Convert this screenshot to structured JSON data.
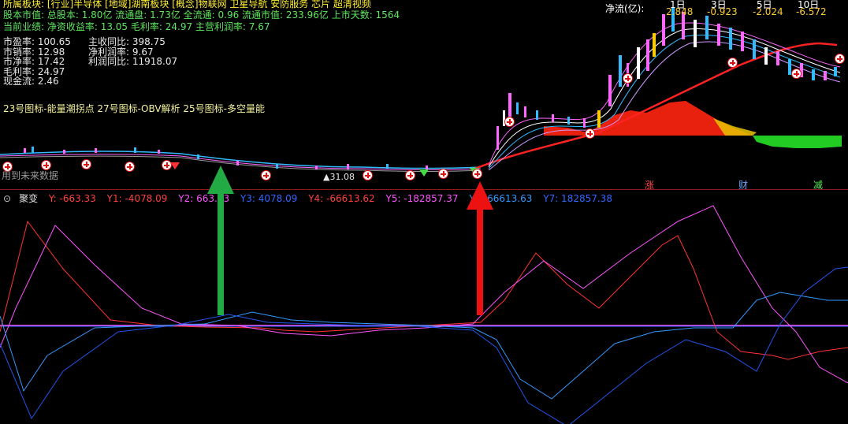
{
  "header": {
    "industry_line": "所属板块: [行业]半导体 [地域]湖南板块 [概念]物联网 卫星导航 安防服务 芯片 超清视频",
    "capital_line": "股本市值: 总股本: 1.80亿 流通盘: 1.73亿 全流通: 0.96 流通市值: 233.96亿 上市天数: 1564",
    "performance_line": "当前业绩:  净资收益率: 13.05 毛利率: 24.97 主营利润率: 7.67"
  },
  "financials": {
    "left": [
      {
        "label": "市盈率:",
        "value": "100.65"
      },
      {
        "label": "市销率:",
        "value": "12.98"
      },
      {
        "label": "市净率:",
        "value": "17.42"
      },
      {
        "label": "毛利率:",
        "value": "24.97"
      },
      {
        "label": "现金流:",
        "value": "2.46"
      }
    ],
    "right": [
      {
        "label": "主收同比:",
        "value": "398.75"
      },
      {
        "label": "净利润率:",
        "value": "9.67"
      },
      {
        "label": "利润同比:",
        "value": "11918.07"
      }
    ]
  },
  "net_flow": {
    "label": "净流(亿):",
    "columns": [
      {
        "head": "1日",
        "value": "2.848"
      },
      {
        "head": "3日",
        "value": "-0.923"
      },
      {
        "head": "5日",
        "value": "-2.024"
      },
      {
        "head": "10日",
        "value": "-6.572"
      }
    ]
  },
  "indicator_caption": "23号图标-能量潮拐点 27号图标-OBV解析 25号图标-多空量能",
  "future_data_text": "用到未来数据",
  "low_price_label": "31.08",
  "badges": {
    "zhang": "涨",
    "cai": "财",
    "jian": "减"
  },
  "lower_panel": {
    "title": "聚变",
    "legend": [
      {
        "label": "Y: -663.33",
        "color": "#ff4040"
      },
      {
        "label": "Y1: -4078.09",
        "color": "#ff4040"
      },
      {
        "label": "Y2: 663.33",
        "color": "#ff55ff"
      },
      {
        "label": "Y3: 4078.09",
        "color": "#3366ff"
      },
      {
        "label": "Y4: -66613.62",
        "color": "#ff4040"
      },
      {
        "label": "Y5: -182857.37",
        "color": "#ff55ff"
      },
      {
        "label": "Y6: 66613.63",
        "color": "#3399ff"
      },
      {
        "label": "Y7: 182857.38",
        "color": "#3366ff"
      }
    ]
  },
  "colors": {
    "up": "#ff3333",
    "down": "#33cc33",
    "arrow_up_green": "#22aa44",
    "arrow_up_red": "#ee1111"
  }
}
